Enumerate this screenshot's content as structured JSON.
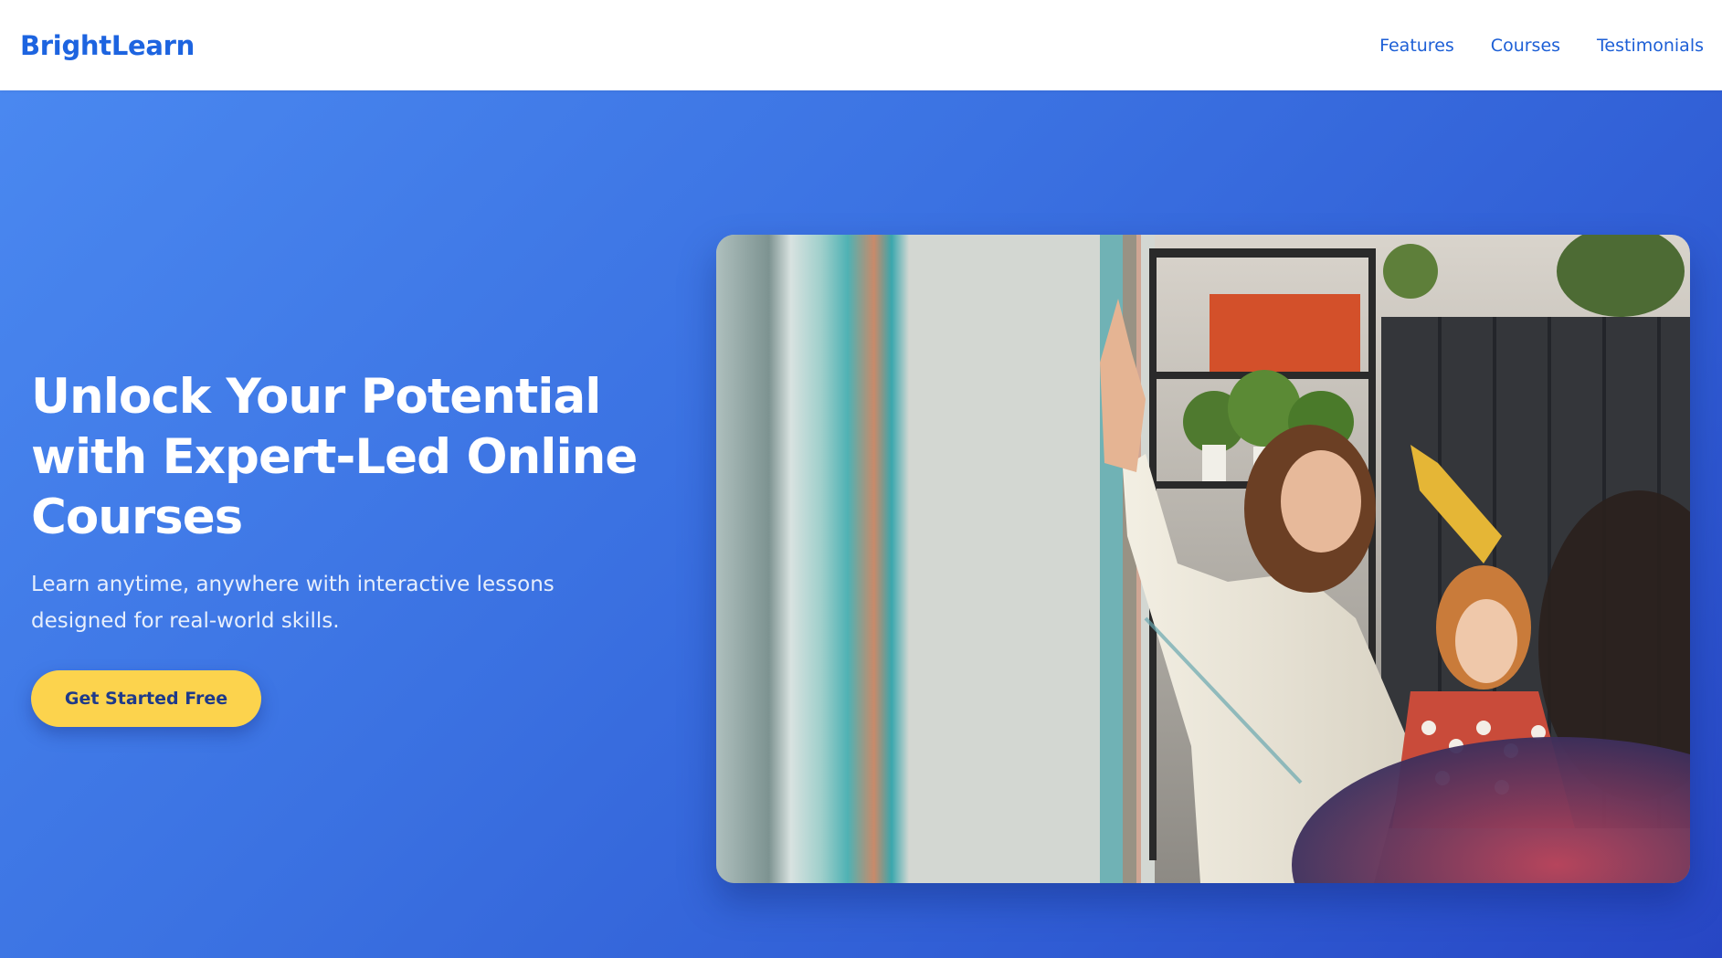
{
  "header": {
    "brand": "BrightLearn",
    "nav": [
      "Features",
      "Courses",
      "Testimonials"
    ]
  },
  "hero": {
    "title": "Unlock Your Potential with Expert-Led Online Courses",
    "subtitle": "Learn anytime, anywhere with interactive lessons designed for real-world skills.",
    "cta_label": "Get Started Free"
  },
  "colors": {
    "brand": "#1d64e0",
    "hero_gradient_start": "#4a88f0",
    "hero_gradient_end": "#2746c4",
    "cta_background": "#fcd34d",
    "cta_text": "#1e3a8a"
  },
  "icons": {
    "hero_image": "classroom-photo"
  }
}
